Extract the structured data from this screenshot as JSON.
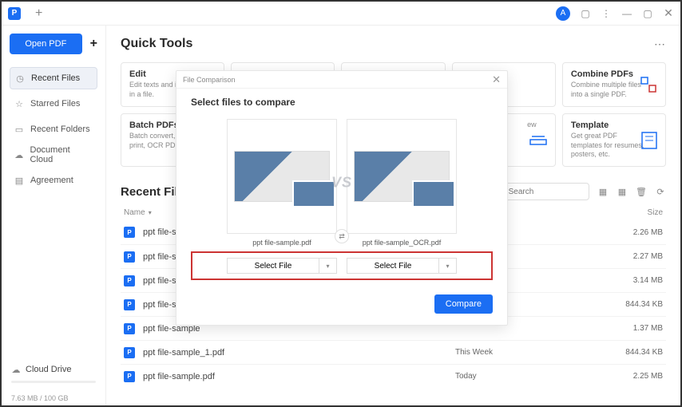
{
  "titlebar": {
    "profile_letter": "A"
  },
  "sidebar": {
    "open_pdf_label": "Open PDF",
    "nav": [
      {
        "icon": "clock",
        "label": "Recent Files",
        "active": true
      },
      {
        "icon": "star",
        "label": "Starred Files",
        "active": false
      },
      {
        "icon": "folder",
        "label": "Recent Folders",
        "active": false
      },
      {
        "icon": "cloud",
        "label": "Document Cloud",
        "active": false
      },
      {
        "icon": "doc",
        "label": "Agreement",
        "active": false
      }
    ],
    "cloud_drive_label": "Cloud Drive",
    "storage_text": "7.63 MB / 100 GB"
  },
  "quick_tools": {
    "title": "Quick Tools",
    "row1": [
      {
        "title": "Edit",
        "desc": "Edit texts and images in a file."
      },
      {
        "title": "",
        "desc": ""
      },
      {
        "title": "",
        "desc": ""
      },
      {
        "title": "",
        "desc": ""
      },
      {
        "title": "Combine PDFs",
        "desc": "Combine multiple files into a single PDF."
      }
    ],
    "row2": [
      {
        "title": "Batch PDFs",
        "desc": "Batch convert, create, print, OCR PDFs, etc."
      },
      {
        "title": "",
        "desc": ""
      },
      {
        "title": "",
        "desc": ""
      },
      {
        "title": "",
        "desc": "ew"
      },
      {
        "title": "Template",
        "desc": "Get great PDF templates for resumes, posters, etc."
      }
    ]
  },
  "recent": {
    "title": "Recent Files",
    "search_placeholder": "Search",
    "columns": {
      "name": "Name",
      "size": "Size"
    },
    "rows": [
      {
        "name": "ppt file-sample",
        "date": "",
        "size": "2.26 MB"
      },
      {
        "name": "ppt file-sample",
        "date": "",
        "size": "2.27 MB"
      },
      {
        "name": "ppt file-sample",
        "date": "",
        "size": "3.14 MB"
      },
      {
        "name": "ppt file-sample",
        "date": "",
        "size": "844.34 KB"
      },
      {
        "name": "ppt file-sample",
        "date": "",
        "size": "1.37 MB"
      },
      {
        "name": "ppt file-sample_1.pdf",
        "date": "This Week",
        "size": "844.34 KB"
      },
      {
        "name": "ppt file-sample.pdf",
        "date": "Today",
        "size": "2.25 MB"
      }
    ]
  },
  "modal": {
    "header": "File Comparison",
    "title": "Select files to compare",
    "vs_label": "VS",
    "left_file": "ppt file-sample.pdf",
    "right_file": "ppt file-sample_OCR.pdf",
    "select_label": "Select File",
    "compare_label": "Compare"
  }
}
